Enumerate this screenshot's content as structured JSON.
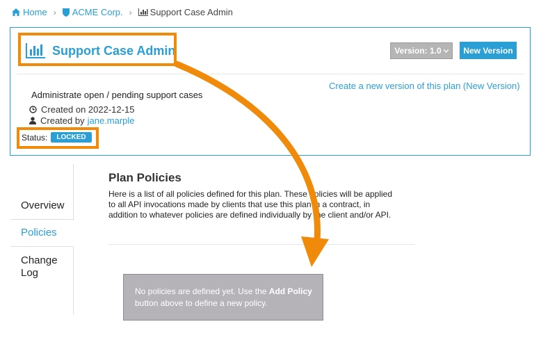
{
  "breadcrumb": {
    "home": "Home",
    "org": "ACME Corp.",
    "current": "Support Case Admin",
    "separator": "›"
  },
  "header": {
    "title": "Support Case Admin",
    "version_label": "Version: 1.0",
    "new_version_button": "New Version",
    "new_version_link": "Create a new version of this plan (New Version)",
    "description": "Administrate open / pending support cases",
    "created_on": "Created on 2022-12-15",
    "created_by_prefix": "Created by",
    "created_by_user": "jane.marple",
    "status_label": "Status:",
    "status_value": "LOCKED"
  },
  "tabs": {
    "overview": "Overview",
    "policies": "Policies",
    "changelog_line1": "Change",
    "changelog_line2": "Log"
  },
  "policies": {
    "title": "Plan Policies",
    "description": "Here is a list of all policies defined for this plan. These policies will be applied to all API invocations made by clients that use this plan in a contract, in addition to whatever policies are defined individually by the client and/or API.",
    "empty_prefix": "No policies are defined yet. Use the",
    "empty_bold": "Add Policy",
    "empty_suffix": "button above to define a new policy."
  },
  "colors": {
    "accent": "#2a9fd6",
    "highlight": "#f08a0a",
    "empty_box": "#b5b3b8"
  },
  "icons": [
    "home-icon",
    "shield-icon",
    "bar-chart-icon",
    "clock-icon",
    "user-icon",
    "caret-down-icon"
  ]
}
